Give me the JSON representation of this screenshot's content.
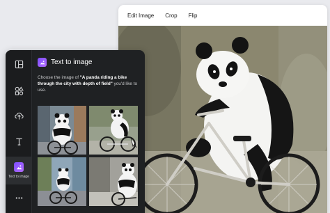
{
  "toolbar": {
    "edit_image": "Edit Image",
    "crop": "Crop",
    "flip": "Flip"
  },
  "panel": {
    "title": "Text to image",
    "description_prefix": "Choose the image of ",
    "prompt": "\"A panda riding a bike through the city with depth of field\"",
    "description_suffix": " you'd like to use.",
    "rail": {
      "active_label": "Text to image",
      "icons": [
        "layout-icon",
        "elements-icon",
        "upload-icon",
        "text-icon",
        "text-to-image-icon",
        "more-icon"
      ]
    },
    "thumbnails": 4
  },
  "colors": {
    "panel_bg": "#1f2123",
    "accent": "#7c4dff"
  }
}
